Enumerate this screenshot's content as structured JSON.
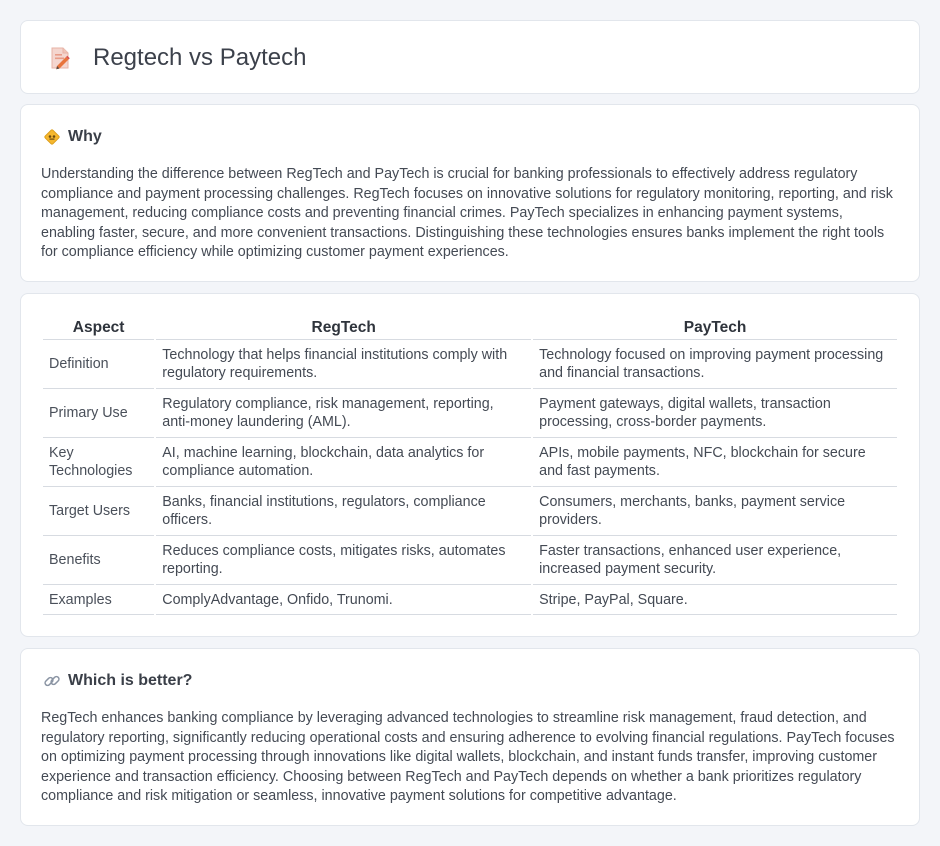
{
  "header": {
    "title": "Regtech vs Paytech",
    "icon": "document-pencil-icon"
  },
  "why": {
    "icon": "diamond-sign-icon",
    "title": "Why",
    "text": "Understanding the difference between RegTech and PayTech is crucial for banking professionals to effectively address regulatory compliance and payment processing challenges. RegTech focuses on innovative solutions for regulatory monitoring, reporting, and risk management, reducing compliance costs and preventing financial crimes. PayTech specializes in enhancing payment systems, enabling faster, secure, and more convenient transactions. Distinguishing these technologies ensures banks implement the right tools for compliance efficiency while optimizing customer payment experiences."
  },
  "table": {
    "headers": [
      "Aspect",
      "RegTech",
      "PayTech"
    ],
    "rows": [
      [
        "Definition",
        "Technology that helps financial institutions comply with regulatory requirements.",
        "Technology focused on improving payment processing and financial transactions."
      ],
      [
        "Primary Use",
        "Regulatory compliance, risk management, reporting, anti-money laundering (AML).",
        "Payment gateways, digital wallets, transaction processing, cross-border payments."
      ],
      [
        "Key Technologies",
        "AI, machine learning, blockchain, data analytics for compliance automation.",
        "APIs, mobile payments, NFC, blockchain for secure and fast payments."
      ],
      [
        "Target Users",
        "Banks, financial institutions, regulators, compliance officers.",
        "Consumers, merchants, banks, payment service providers."
      ],
      [
        "Benefits",
        "Reduces compliance costs, mitigates risks, automates reporting.",
        "Faster transactions, enhanced user experience, increased payment security."
      ],
      [
        "Examples",
        "ComplyAdvantage, Onfido, Trunomi.",
        "Stripe, PayPal, Square."
      ]
    ]
  },
  "better": {
    "icon": "link-icon",
    "title": "Which is better?",
    "text": "RegTech enhances banking compliance by leveraging advanced technologies to streamline risk management, fraud detection, and regulatory reporting, significantly reducing operational costs and ensuring adherence to evolving financial regulations. PayTech focuses on optimizing payment processing through innovations like digital wallets, blockchain, and instant funds transfer, improving customer experience and transaction efficiency. Choosing between RegTech and PayTech depends on whether a bank prioritizes regulatory compliance and risk mitigation or seamless, innovative payment solutions for competitive advantage."
  }
}
